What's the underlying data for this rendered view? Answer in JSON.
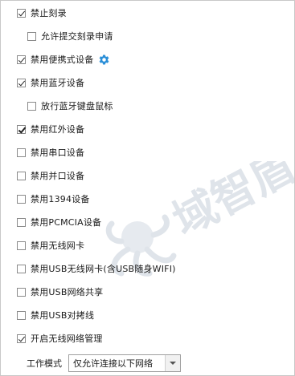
{
  "options": [
    {
      "label": "禁止刻录",
      "checked": true
    },
    {
      "label": "允许提交刻录申请",
      "checked": false
    },
    {
      "label": "禁用便携式设备",
      "checked": true,
      "settings_icon": "gear-icon",
      "icon_color": "#2b8fd8"
    },
    {
      "label": "禁用蓝牙设备",
      "checked": true
    },
    {
      "label": "放行蓝牙键盘鼠标",
      "checked": false
    },
    {
      "label": "禁用红外设备",
      "checked": true
    },
    {
      "label": "禁用串口设备",
      "checked": false
    },
    {
      "label": "禁用并口设备",
      "checked": false
    },
    {
      "label": "禁用1394设备",
      "checked": false
    },
    {
      "label": "禁用PCMCIA设备",
      "checked": false
    },
    {
      "label": "禁用无线网卡",
      "checked": false
    },
    {
      "label": "禁用USB无线网卡(含USB随身WIFI)",
      "checked": false
    },
    {
      "label": "禁用USB网络共享",
      "checked": false
    },
    {
      "label": "禁用USB对拷线",
      "checked": false
    },
    {
      "label": "开启无线网络管理",
      "checked": true
    }
  ],
  "work_mode": {
    "label": "工作模式",
    "selected": "仅允许连接以下网络"
  },
  "watermark": {
    "text": "域智盾",
    "icon": "octopus-logo-icon",
    "color": "#dfe4ea"
  }
}
